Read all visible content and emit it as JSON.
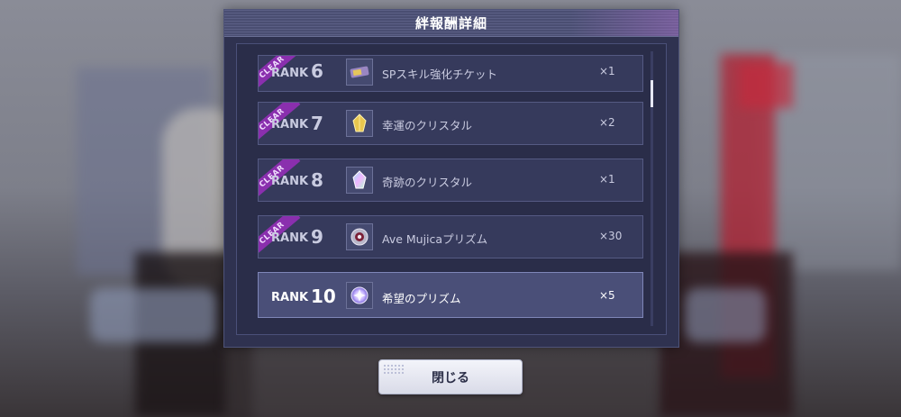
{
  "dialog": {
    "title": "絆報酬詳細",
    "close_label": "閉じる"
  },
  "rewards": [
    {
      "clear_badge": "CLEAR",
      "rank_label": "RANK",
      "rank": "6",
      "item": "SPスキル強化チケット",
      "qty": "×1",
      "icon": "ticket-icon",
      "cleared": true
    },
    {
      "clear_badge": "CLEAR",
      "rank_label": "RANK",
      "rank": "7",
      "item": "幸運のクリスタル",
      "qty": "×2",
      "icon": "yellow-crystal-icon",
      "cleared": true
    },
    {
      "clear_badge": "CLEAR",
      "rank_label": "RANK",
      "rank": "8",
      "item": "奇跡のクリスタル",
      "qty": "×1",
      "icon": "rainbow-crystal-icon",
      "cleared": true
    },
    {
      "clear_badge": "CLEAR",
      "rank_label": "RANK",
      "rank": "9",
      "item": "Ave Mujicaプリズム",
      "qty": "×30",
      "icon": "band-prism-icon",
      "cleared": true
    },
    {
      "rank_label": "RANK",
      "rank": "10",
      "item": "希望のプリズム",
      "qty": "×5",
      "icon": "hope-prism-icon",
      "cleared": false
    }
  ],
  "colors": {
    "panel": "#2f3250",
    "clear_ribbon": "#8a2fae",
    "active_row": "#4a4f78"
  }
}
